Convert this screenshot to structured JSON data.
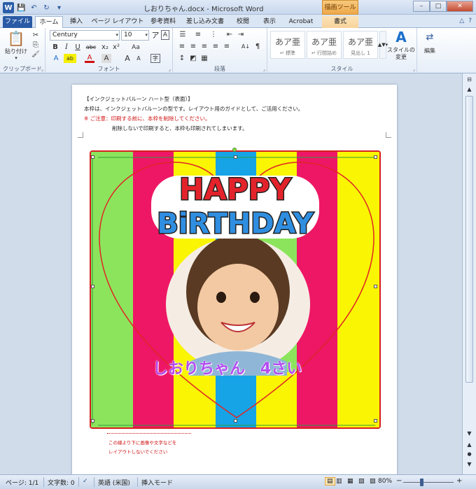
{
  "window": {
    "title": "しおりちゃん.docx - Microsoft Word",
    "context_tool_label": "描画ツール",
    "buttons": {
      "minimize": "–",
      "maximize": "□",
      "close": "✕"
    }
  },
  "quick_access": {
    "logo": "W",
    "save": "💾",
    "undo": "↶",
    "redo": "↻",
    "customize": "▾"
  },
  "tabs": [
    {
      "label": "ファイル"
    },
    {
      "label": "ホーム"
    },
    {
      "label": "挿入"
    },
    {
      "label": "ページ レイアウト"
    },
    {
      "label": "参考資料"
    },
    {
      "label": "差し込み文書"
    },
    {
      "label": "校閲"
    },
    {
      "label": "表示"
    },
    {
      "label": "Acrobat"
    },
    {
      "label": "書式"
    }
  ],
  "tab_icons": {
    "minimize_ribbon": "△",
    "help": "?"
  },
  "ribbon": {
    "clipboard": {
      "label": "クリップボード",
      "paste_label": "貼り付け",
      "paste_menu": "▾",
      "cut": "✂",
      "copy": "⎘",
      "format_painter": "🖌"
    },
    "font": {
      "label": "フォント",
      "font_name": "Century",
      "font_size": "10",
      "dropdown": "▾",
      "grow": "A",
      "shrink": "A",
      "case": "Aa",
      "clear": "A",
      "bold": "B",
      "italic": "I",
      "underline": "U",
      "strike": "abc",
      "sub": "x₂",
      "sup": "x²",
      "text_effect": "A",
      "highlight": "ab",
      "font_color": "A",
      "char_shading": "A",
      "phonetic": "ア",
      "enclose": "字"
    },
    "paragraph": {
      "label": "段落",
      "bullets": "☰",
      "numbering": "≡",
      "multilevel": "⋮",
      "decrease_indent": "⇤",
      "increase_indent": "⇥",
      "sort": "A↓",
      "show_marks": "¶",
      "align_left": "≡",
      "center": "≡",
      "align_right": "≡",
      "justify": "≡",
      "distributed": "≡",
      "line_spacing": "↕",
      "shading": "◩",
      "borders": "▦"
    },
    "styles": {
      "label": "スタイル",
      "items": [
        {
          "preview": "あア亜",
          "name": "↵ 標準"
        },
        {
          "preview": "あア亜",
          "name": "↵ 行間詰め"
        },
        {
          "preview": "あア亜",
          "name": "見出し 1"
        }
      ],
      "change_styles_label": "スタイルの変更",
      "change_styles_icon": "A"
    },
    "editing": {
      "label": "編集",
      "icon": "⇄"
    }
  },
  "document": {
    "lines": [
      "【インクジェットバルーン ハート型（表面）】",
      "本枠は、インクジェットバルーンの型です。レイアウト用のガイドとして、ご活用ください。",
      "※ ご注意：印刷する前に、本枠を削除してください。",
      "削除しないで印刷すると、本枠も印刷されてしまいます。"
    ],
    "artwork": {
      "title_top": "HAPPY",
      "title_bottom": "BiRTHDAY",
      "caption": "しおりちゃん　4さい",
      "stripe_colors": [
        "#8ce45c",
        "#ee1765",
        "#f9f503",
        "#16a4e6",
        "#f9f503",
        "#8ce45c",
        "#ee1765",
        "#f9f503"
      ]
    },
    "footer_note": [
      "この線より下に画像や文字などを",
      "レイアウトしないでください"
    ]
  },
  "statusbar": {
    "page": "ページ: 1/1",
    "words": "文字数: 0",
    "proof_icon": "✓",
    "language": "英語 (米国)",
    "insert_mode": "挿入モード",
    "zoom": "80%",
    "zoom_out": "−",
    "zoom_in": "+",
    "view_icons": [
      "▤",
      "▥",
      "▦",
      "▧",
      "▨"
    ]
  },
  "scrollbar": {
    "up": "▲",
    "down": "▼",
    "prev": "▲",
    "select": "●",
    "next": "▼",
    "ruler": "⊟"
  }
}
